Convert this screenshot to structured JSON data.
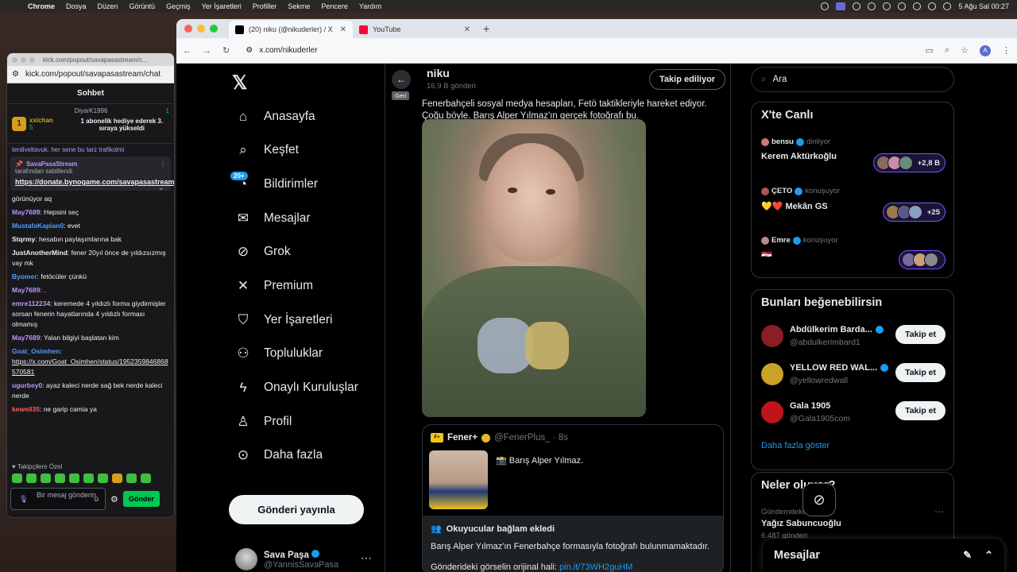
{
  "menubar": {
    "app": "Chrome",
    "items": [
      "Dosya",
      "Düzen",
      "Görüntü",
      "Geçmiş",
      "Yer İşaretleri",
      "Profiller",
      "Sekme",
      "Pencere",
      "Yardım"
    ],
    "clock": "5 Ağu Sal  00:27"
  },
  "chat_window": {
    "url_short": "kick.com/popout/savapasastream/c...",
    "url": "kick.com/popout/savapasastream/chat",
    "header": "Sohbet",
    "leader1": {
      "name": "xxichan",
      "count": "5",
      "rank": "1"
    },
    "leader2": {
      "name": "DiyarK1996",
      "count": "1",
      "text": "1 abonelik hediye ederek 3. sıraya yükseldi"
    },
    "pinned": {
      "streamer": "SavaPasaStream",
      "caption": "tarafından sabitlendi",
      "link": "https://donate.bynogame.com/savapasastream"
    },
    "partial_top": "terdiveltavuk: her sene bu tarz trafikolmi",
    "messages": [
      {
        "user": "",
        "text": "görünüyor aq",
        "color": "#efeff1"
      },
      {
        "user": "May7689",
        "text": ": Hepsini seç",
        "color": "#bf94ff"
      },
      {
        "user": "MustafaKapian0",
        "text": ": evet",
        "color": "#4f9dff"
      },
      {
        "user": "Stqrmy",
        "text": ": hesabın paylaşımlarına bak",
        "color": "#00e676"
      },
      {
        "user": "JustAnotherMind",
        "text": ": fener 20yıl önce de yıldızsızmış vay mk",
        "color": "#00e676"
      },
      {
        "user": "Byomer",
        "text": ": fetöcüler çünkü",
        "color": "#4f9dff"
      },
      {
        "user": "May7689",
        "text": ": .",
        "color": "#bf94ff"
      },
      {
        "user": "emre112234",
        "text": ": keremede 4 yıldızlı forma giydirmişler sorsan fenerin hayatlarında 4 yıldızlı forması olmamış",
        "color": "#bf94ff"
      },
      {
        "user": "May7689",
        "text": ": Yalan bilgiyi başlatan kim",
        "color": "#bf94ff"
      },
      {
        "user": "Goat_Osimhen",
        "text": ":",
        "color": "#4f9dff",
        "link": "https://x.com/Goat_Osimhen/status/1952359846868570581"
      },
      {
        "user": "ugurbey0",
        "text": ": ayaz kaleci nerde sağ bek nerde kaleci nerde",
        "color": "#bf94ff"
      },
      {
        "user": "kewell35",
        "text": ": ne garip camia ya",
        "color": "#ff5c5c"
      }
    ],
    "footer_label": "Takipçilere Özel",
    "input_placeholder": "Bir mesaj gönderin",
    "send_label": "Gönder"
  },
  "browser": {
    "tabs": [
      {
        "title": "(20) niku (@nikuderler) / X",
        "active": true
      },
      {
        "title": "YouTube",
        "active": false
      }
    ],
    "address": "x.com/nikuderler",
    "profile_initial": "A"
  },
  "x": {
    "nav": [
      {
        "label": "Anasayfa",
        "icon": "home-icon",
        "glyph": "⌂"
      },
      {
        "label": "Keşfet",
        "icon": "search-icon",
        "glyph": "⌕"
      },
      {
        "label": "Bildirimler",
        "icon": "bell-icon",
        "glyph": "🔔"
      },
      {
        "label": "Mesajlar",
        "icon": "mail-icon",
        "glyph": "✉"
      },
      {
        "label": "Grok",
        "icon": "grok-icon",
        "glyph": "⊘"
      },
      {
        "label": "Premium",
        "icon": "x-premium-icon",
        "glyph": "✕"
      },
      {
        "label": "Yer İşaretleri",
        "icon": "bookmark-icon",
        "glyph": "⛉"
      },
      {
        "label": "Topluluklar",
        "icon": "communities-icon",
        "glyph": "⚇"
      },
      {
        "label": "Onaylı Kuruluşlar",
        "icon": "lightning-icon",
        "glyph": "ϟ"
      },
      {
        "label": "Profil",
        "icon": "profile-icon",
        "glyph": "♙"
      },
      {
        "label": "Daha fazla",
        "icon": "more-circle-icon",
        "glyph": "⊙"
      }
    ],
    "notif_badge": "20+",
    "post_button": "Gönderi yayınla",
    "account": {
      "name": "Sava Paşa",
      "handle": "@YannisSavaPasa"
    },
    "profile": {
      "name": "niku",
      "post_count": "16,9 B gönderi",
      "follow_label": "Takip ediliyor",
      "back_tip": "Geri"
    },
    "tweet_text": "Fenerbahçeli sosyal medya hesapları, Fetö taktikleriyle hareket ediyor. Çoğu böyle. Barış Alper Yılmaz'ın gerçek fotoğrafı bu.",
    "quote": {
      "name": "Fener+",
      "handle": "@FenerPlus_ · 8s",
      "logo": "F+",
      "text": "📸 Barış Alper Yılmaz."
    },
    "context": {
      "title": "Okuyucular bağlam ekledi",
      "body": "Barış Alper Yılmaz'ın Fenerbahçe formasıyla fotoğrafı bulunmamaktadır.",
      "link_prefix": "Gönderideki görselin orijinal hali: ",
      "link": "pin.it/73WH2guHM"
    },
    "search_placeholder": "Ara",
    "live": {
      "title": "X'te Canlı",
      "items": [
        {
          "host": "bensu",
          "status": "dinliyor",
          "title": "Kerem Aktürkoğlu",
          "count": "+2,8 B"
        },
        {
          "host": "ÇETO",
          "status": "konuşuyor",
          "title": "💛❤️ Mekân GS",
          "count": "+25"
        },
        {
          "host": "Emre",
          "status": "konuşuyor",
          "title": "🇮🇶",
          "count": ""
        }
      ]
    },
    "suggestions": {
      "title": "Bunları beğenebilirsin",
      "items": [
        {
          "name": "Abdülkerim Barda...",
          "handle": "@abdulkerimbard1",
          "button": "Takip et",
          "color": "#8b1d24"
        },
        {
          "name": "YELLOW RED WAL...",
          "handle": "@yellowredwall",
          "button": "Takip et",
          "color": "#c9a227"
        },
        {
          "name": "Gala 1905",
          "handle": "@Gala1905com",
          "button": "Takip et",
          "color": "#c0141c"
        }
      ],
      "show_more": "Daha fazla göster"
    },
    "trends": {
      "title": "Neler oluyor?",
      "meta": "Gündemdekiler",
      "topic": "Yağız Sabuncuoğlu",
      "count": "6.487 gönderi"
    },
    "messages_drawer": "Mesajlar"
  }
}
